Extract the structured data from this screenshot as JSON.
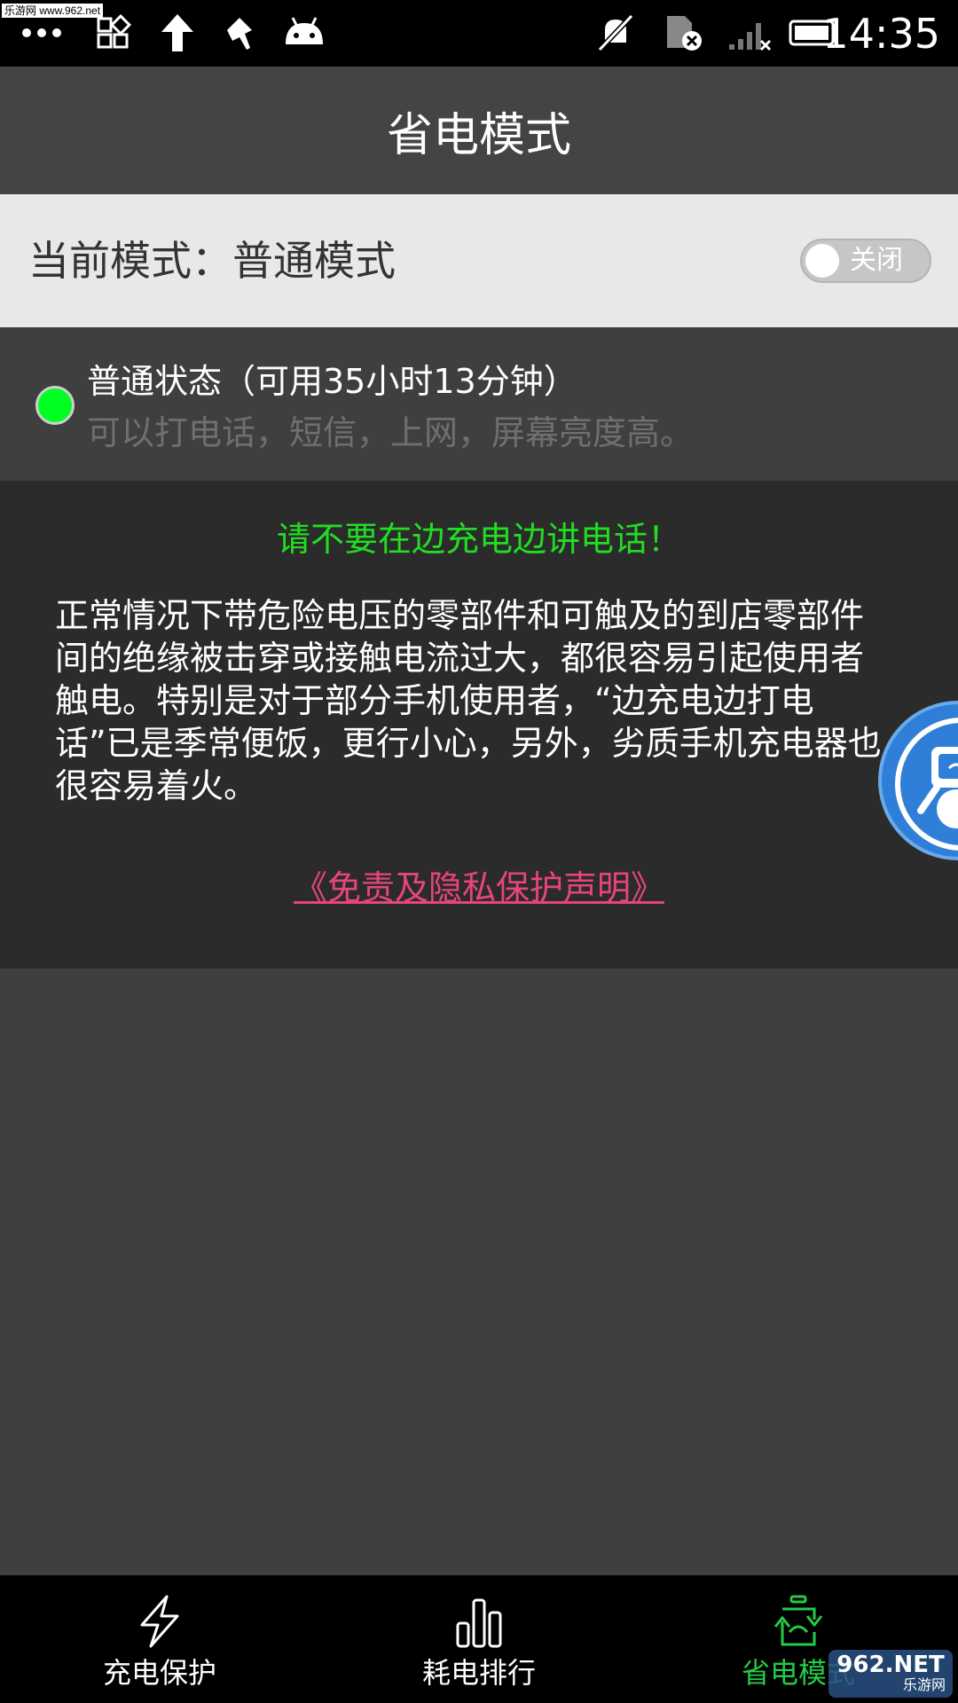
{
  "status_bar": {
    "watermark": "乐游网 www.962.net",
    "time": "14:35",
    "icons": [
      "more-dots-icon",
      "apps-grid-icon",
      "upload-arrow-icon",
      "pin-icon",
      "android-icon",
      "mute-bell-icon",
      "sim-card-x-icon",
      "signal-x-icon",
      "battery-icon"
    ]
  },
  "header": {
    "title": "省电模式"
  },
  "mode_row": {
    "label": "当前模式：普通模式",
    "toggle_label": "关闭"
  },
  "state_row": {
    "title": "普通状态（可用35小时13分钟）",
    "description": "可以打电话，短信，上网，屏幕亮度高。",
    "indicator_color": "#00ff22"
  },
  "warning": {
    "title": "请不要在边充电边讲电话！",
    "body": "正常情况下带危险电压的零部件和可触及的到店零部件间的绝缘被击穿或接触电流过大，都很容易引起使用者触电。特别是对于部分手机使用者，“边充电边打电话”已是季常便饭，更行小心，另外，劣质手机充电器也很容易着火。",
    "link": "《免责及隐私保护声明》"
  },
  "bottom_nav": {
    "items": [
      {
        "label": "充电保护",
        "icon": "lightning-icon",
        "active": false
      },
      {
        "label": "耗电排行",
        "icon": "bar-chart-icon",
        "active": false
      },
      {
        "label": "省电模式",
        "icon": "battery-cycle-icon",
        "active": true
      }
    ],
    "active_color": "#22cc44"
  },
  "watermark_bottom": {
    "main": "962.NET",
    "sub": "乐游网"
  }
}
